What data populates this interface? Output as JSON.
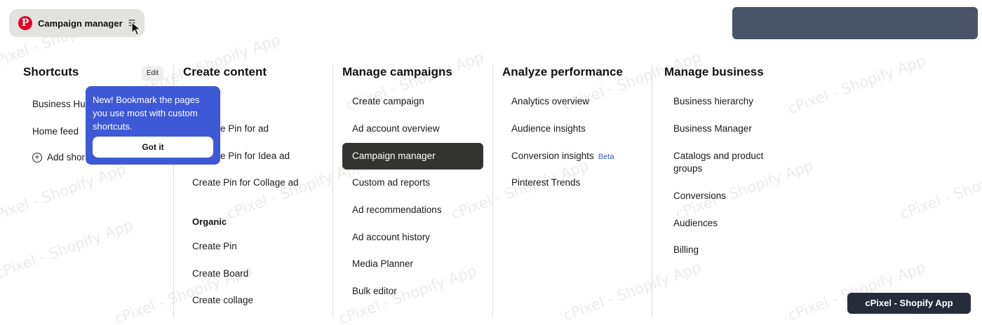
{
  "header": {
    "logo_glyph": "P",
    "title": "Campaign manager",
    "menu_glyph": "☰"
  },
  "shortcuts": {
    "title": "Shortcuts",
    "edit_label": "Edit",
    "items": [
      "Business Hu",
      "Home feed"
    ],
    "add_label": "Add shor"
  },
  "tooltip": {
    "text": "New! Bookmark the pages you use most with custom shortcuts.",
    "button": "Got it"
  },
  "create_content": {
    "title": "Create content",
    "ads_items": [
      "e Pin for ad",
      "e Pin for Idea ad",
      "Create Pin for Collage ad"
    ],
    "organic_label": "Organic",
    "organic_items": [
      "Create Pin",
      "Create Board",
      "Create collage"
    ]
  },
  "manage_campaigns": {
    "title": "Manage campaigns",
    "items": [
      "Create campaign",
      "Ad account overview",
      "Campaign manager",
      "Custom ad reports",
      "Ad recommendations",
      "Ad account history",
      "Media Planner",
      "Bulk editor"
    ],
    "active_index": 2
  },
  "analyze_performance": {
    "title": "Analyze performance",
    "items": [
      "Analytics overview",
      "Audience insights",
      "Conversion insights",
      "Pinterest Trends"
    ],
    "beta_label": "Beta"
  },
  "manage_business": {
    "title": "Manage business",
    "items": [
      "Business hierarchy",
      "Business Manager",
      "Catalogs and product groups",
      "Conversions",
      "Audiences",
      "Billing"
    ]
  },
  "watermark": {
    "text": "cPixel - Shopify App",
    "badge": "cPixel - Shopify App"
  }
}
